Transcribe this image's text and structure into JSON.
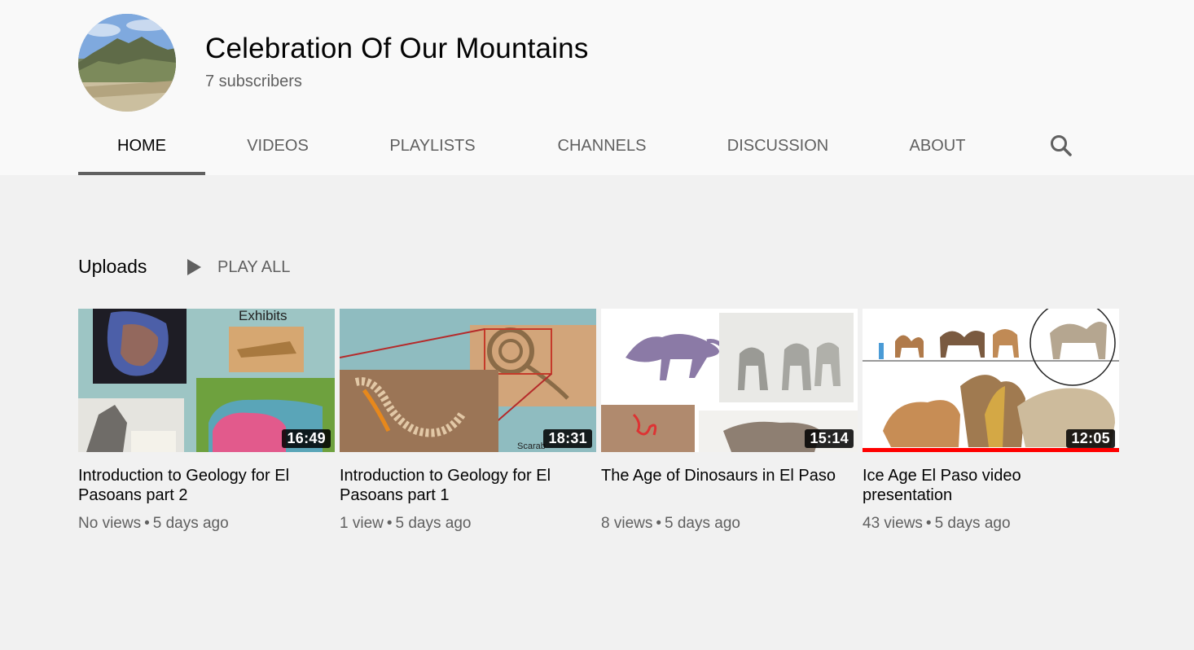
{
  "channel": {
    "name": "Celebration Of Our Mountains",
    "subscribers": "7 subscribers",
    "avatar_icon": "mountain-landscape-avatar"
  },
  "tabs": [
    {
      "label": "HOME",
      "active": true
    },
    {
      "label": "VIDEOS",
      "active": false
    },
    {
      "label": "PLAYLISTS",
      "active": false
    },
    {
      "label": "CHANNELS",
      "active": false
    },
    {
      "label": "DISCUSSION",
      "active": false
    },
    {
      "label": "ABOUT",
      "active": false
    }
  ],
  "search_icon": "search-icon",
  "uploads": {
    "title": "Uploads",
    "play_all": "PLAY ALL",
    "videos": [
      {
        "title": "Introduction to Geology for El Pasoans part 2",
        "duration": "16:49",
        "views": "No views",
        "age": "5 days ago",
        "thumb_text": "Exhibits",
        "watched_fraction": 0
      },
      {
        "title": "Introduction to Geology for El Pasoans part 1",
        "duration": "18:31",
        "views": "1 view",
        "age": "5 days ago",
        "thumb_text": "Scarab",
        "watched_fraction": 0
      },
      {
        "title": "The Age of Dinosaurs in El Paso",
        "duration": "15:14",
        "views": "8 views",
        "age": "5 days ago",
        "watched_fraction": 0
      },
      {
        "title": "Ice Age El Paso video presentation",
        "duration": "12:05",
        "views": "43 views",
        "age": "5 days ago",
        "watched_fraction": 1
      }
    ]
  },
  "colors": {
    "header_bg": "#f9f9f9",
    "page_bg": "#f1f1f1",
    "text_primary": "#030303",
    "text_secondary": "#606060",
    "progress": "#ff0000"
  }
}
